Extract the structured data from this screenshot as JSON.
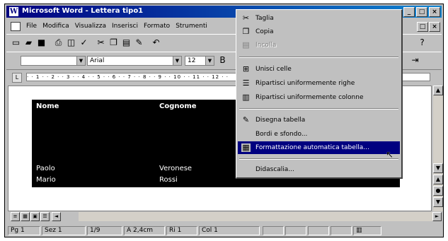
{
  "window": {
    "title": "Microsoft Word - Lettera tipo1",
    "title_icon": "word-icon",
    "caption_buttons": [
      "_",
      "□",
      "×"
    ]
  },
  "menubar": {
    "items": [
      "File",
      "Modifica",
      "Visualizza",
      "Inserisci",
      "Formato",
      "Strumenti"
    ],
    "open_item": "Strumenti"
  },
  "formatting": {
    "font_name": "Arial",
    "font_size": "12"
  },
  "ruler": {
    "marks": "· · 1 · · 2 · · 3 · · 4 · · 5 · · 6 · · 7 · · 8 · · 9 · · 10 · · 11 · · 12 · ·"
  },
  "document": {
    "table": {
      "headers": [
        "Nome",
        "Cognome"
      ],
      "rows": [
        [
          "Paolo",
          "Veronese"
        ],
        [
          "Mario",
          "Rossi"
        ]
      ]
    }
  },
  "context_menu": {
    "items": [
      {
        "label": "Taglia",
        "icon": "scissors-icon",
        "enabled": true
      },
      {
        "label": "Copia",
        "icon": "copy-icon",
        "enabled": true
      },
      {
        "label": "Incolla",
        "icon": "paste-icon",
        "enabled": false
      },
      {
        "label": "Unisci celle",
        "icon": "merge-cells-icon",
        "enabled": true
      },
      {
        "label": "Ripartisci uniformemente righe",
        "icon": "distribute-rows-icon",
        "enabled": true
      },
      {
        "label": "Ripartisci uniformemente colonne",
        "icon": "distribute-columns-icon",
        "enabled": true
      },
      {
        "label": "Disegna tabella",
        "icon": "pencil-icon",
        "enabled": true
      },
      {
        "label": "Bordi e sfondo...",
        "icon": "",
        "enabled": true
      },
      {
        "label": "Formattazione automatica tabella...",
        "icon": "autoformat-icon",
        "enabled": true,
        "selected": true
      },
      {
        "label": "Didascalia...",
        "icon": "",
        "enabled": true
      }
    ]
  },
  "statusbar": {
    "page": "Pg 1",
    "section": "Sez 1",
    "page_of": "1/9",
    "position": "A 2,4cm",
    "line": "Ri 1",
    "column": "Col 1"
  },
  "colors": {
    "title_active": "#000080",
    "menu_highlight": "#000080",
    "chrome": "#c0c0c0",
    "table_fill": "#000000"
  }
}
